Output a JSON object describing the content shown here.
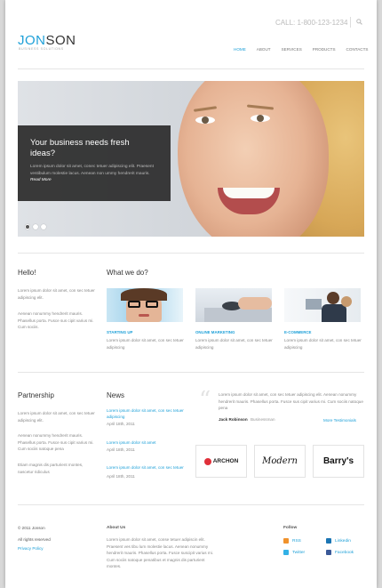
{
  "header": {
    "logo_left": "JON",
    "logo_right": "SON",
    "tagline": "BUSINESS SOLUTIONS",
    "phone": "CALL: 1-800-123-1234",
    "nav": [
      {
        "label": "Home",
        "active": true
      },
      {
        "label": "About",
        "active": false
      },
      {
        "label": "Services",
        "active": false
      },
      {
        "label": "Products",
        "active": false
      },
      {
        "label": "Contacts",
        "active": false
      }
    ]
  },
  "slider": {
    "title": "Your business needs fresh ideas?",
    "text": "Lorem ipsum dolor sit amet, conec tetuer adipiscing elit. Praesent vestibulum molestie lacus. Aenean non ummy hendrerit mauris.",
    "more": "Read More"
  },
  "hello": {
    "title": "Hello!",
    "p1": "Lorem ipsum dolor sit amet, con sec tetuer adipiscing elit.",
    "p2": "Aenean nonummy hendrerit mauris. Phasellus porta. Fusce sus cipit varius mi. Cum sociis."
  },
  "whatwedo": {
    "title": "What we do?",
    "items": [
      {
        "caption": "Starting up",
        "text": "Lorem ipsum dolor sit amet, con sec tetuer adipiscing"
      },
      {
        "caption": "Online marketing",
        "text": "Lorem ipsum dolor sit amet, con sec tetuer adipiscing"
      },
      {
        "caption": "E-commerce",
        "text": "Lorem ipsum dolor sit amet, con sec tetuer adipiscing"
      }
    ]
  },
  "partnership": {
    "title": "Partnership",
    "p1": "Lorem ipsum dolor sit amet, con sec tetuer adipiscing elit.",
    "p2": "Aenean nonummy hendrerit mauris. Phasellus porta. Fusce sus cipit varius mi. Cum sociis natoque pena",
    "p3": "Etiam magnis dis parturient montes, nascetur ridiculus"
  },
  "news": {
    "title": "News",
    "items": [
      {
        "link": "Lorem ipsum dolor sit amet, con sec tetuer adipiscing",
        "date": "April 18th, 2011"
      },
      {
        "link": "Lorem ipsum dolor sit amet",
        "date": "April 18th, 2011"
      },
      {
        "link": "Lorem ipsum dolor sit amet, con sec tetuer",
        "date": "April 18th, 2011"
      }
    ]
  },
  "testimonial": {
    "text": "Lorem ipsum dolor sit amet, con sec tetuer adipiscing elit. Aenean nonummy hendrerit mauris. Phasellus porta. Fusce sus cipit varius mi. Cum sociis natoque pena",
    "author": "Jack Robinson",
    "role": "Businessman",
    "more": "More Testimonials"
  },
  "clients": [
    "ARCHON",
    "Modern",
    "Barry's"
  ],
  "footer": {
    "copyright": "© 2011 Jonson",
    "rights": "All rights reserved",
    "privacy": "Privacy Policy",
    "about_title": "About Us",
    "about_text": "Lorem ipsum dolor sit amet, conse tetuer adipiscin elit. Praesent ves tibu lum molestie lacus. Aenean nonummy hendrerit mauris. Phasellus porta. Fusce suscipit varius mi. Cum sociis natoque penatibus et magnis dis parturient montes.",
    "follow_title": "Follow",
    "social": [
      {
        "label": "RSS",
        "color": "#f0922c"
      },
      {
        "label": "Linkedin",
        "color": "#1b75b3"
      },
      {
        "label": "Twitter",
        "color": "#33b1e6"
      },
      {
        "label": "Facebook",
        "color": "#3b5998"
      }
    ]
  },
  "colors": {
    "accent": "#1ea0d8",
    "dark_box": "#2a2a2a"
  }
}
